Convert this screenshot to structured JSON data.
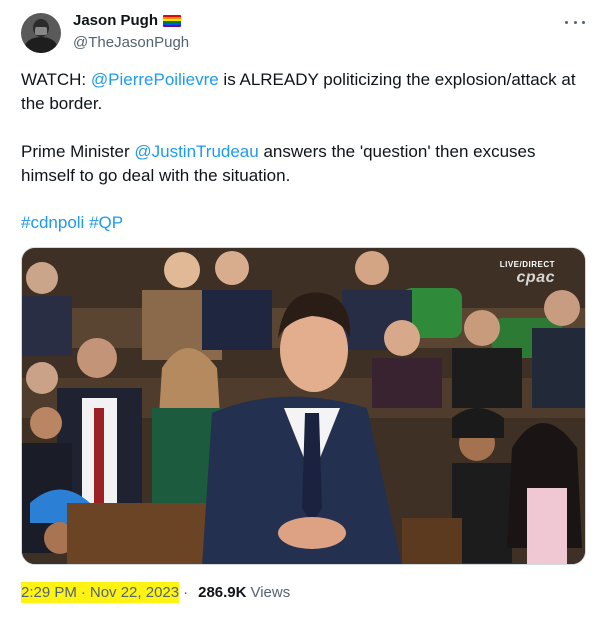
{
  "author": {
    "name": "Jason Pugh",
    "handle": "@TheJasonPugh",
    "badge_icon": "rainbow-flag-icon"
  },
  "tweet": {
    "line1_prefix": "WATCH: ",
    "mention1": "@PierrePoilievre",
    "line1_suffix": " is ALREADY politicizing the explosion/attack at the border.",
    "line2_prefix": "Prime Minister ",
    "mention2": "@JustinTrudeau",
    "line2_suffix": " answers the 'question' then excuses himself to go deal with the situation.",
    "hashtag1": "#cdnpoli",
    "hashtag2": "#QP"
  },
  "media": {
    "live_label": "LIVE/DIRECT",
    "channel_logo": "cpac"
  },
  "footer": {
    "time": "2:29 PM",
    "separator": "·",
    "date": "Nov 22, 2023",
    "views_count": "286.9K",
    "views_label": "Views",
    "highlight_color": "#fff314"
  },
  "colors": {
    "link": "#1d9bf0",
    "text": "#0f1419",
    "secondary": "#536471"
  }
}
